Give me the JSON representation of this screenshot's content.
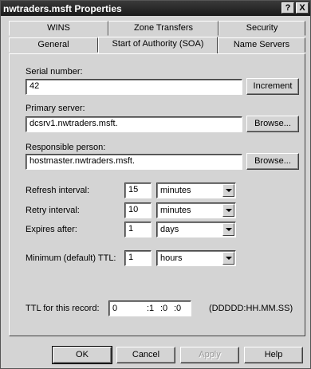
{
  "window": {
    "title": "nwtraders.msft Properties",
    "help_label": "?",
    "close_label": "X"
  },
  "tabs_row1": [
    "WINS",
    "Zone Transfers",
    "Security"
  ],
  "tabs_row2": [
    "General",
    "Start of Authority (SOA)",
    "Name Servers"
  ],
  "active_tab": "Start of Authority (SOA)",
  "soa": {
    "serial_label": "Serial number:",
    "serial_value": "42",
    "increment_label": "Increment",
    "primary_label": "Primary server:",
    "primary_value": "dcsrv1.nwtraders.msft.",
    "responsible_label": "Responsible person:",
    "responsible_value": "hostmaster.nwtraders.msft.",
    "browse_label": "Browse...",
    "refresh_label": "Refresh interval:",
    "refresh_value": "15",
    "refresh_unit": "minutes",
    "retry_label": "Retry interval:",
    "retry_value": "10",
    "retry_unit": "minutes",
    "expires_label": "Expires after:",
    "expires_value": "1",
    "expires_unit": "days",
    "minttl_label": "Minimum (default) TTL:",
    "minttl_value": "1",
    "minttl_unit": "hours",
    "ttl_label": "TTL for this record:",
    "ttl_days": "0",
    "ttl_hours": ":1",
    "ttl_minutes": ":0",
    "ttl_seconds": ":0",
    "ttl_format": "(DDDDD:HH.MM.SS)"
  },
  "footer": {
    "ok_label": "OK",
    "cancel_label": "Cancel",
    "apply_label": "Apply",
    "help_label": "Help"
  }
}
